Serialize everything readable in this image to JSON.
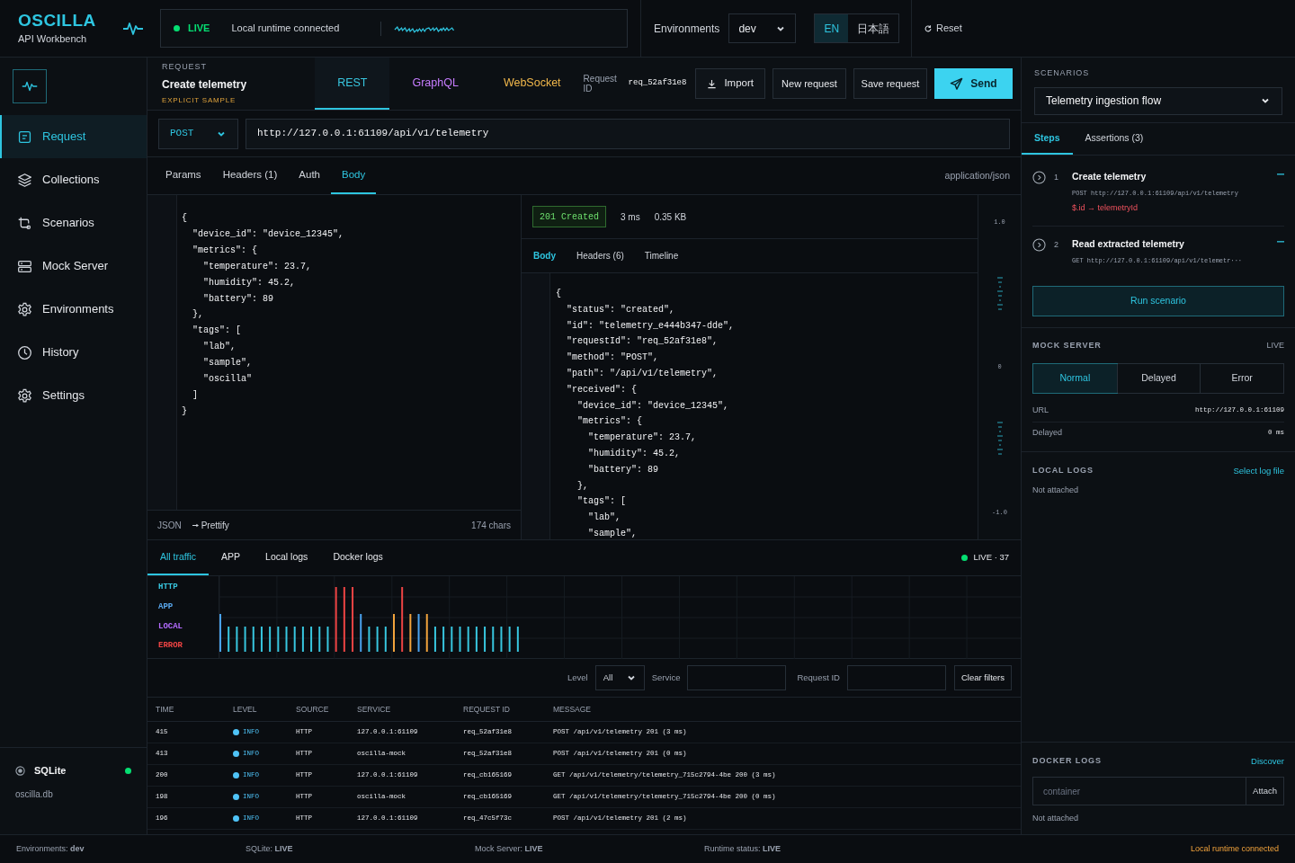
{
  "brand": {
    "name": "OSCILLA",
    "subtitle": "API Workbench"
  },
  "live_banner": {
    "status": "LIVE",
    "message": "Local runtime connected"
  },
  "environment": {
    "label": "Environments",
    "value": "dev"
  },
  "languages": [
    {
      "label": "EN",
      "selected": true
    },
    {
      "label": "日本語",
      "selected": false
    }
  ],
  "reset": "Reset",
  "sidebar": {
    "items": [
      {
        "label": "Request",
        "selected": true
      },
      {
        "label": "Collections",
        "selected": false
      },
      {
        "label": "Scenarios",
        "selected": false
      },
      {
        "label": "Mock Server",
        "selected": false
      },
      {
        "label": "Environments",
        "selected": false
      },
      {
        "label": "History",
        "selected": false
      },
      {
        "label": "Settings",
        "selected": false
      }
    ],
    "database": {
      "name": "SQLite",
      "file": "oscilla.db",
      "connected": true
    }
  },
  "request": {
    "eyebrow": "REQUEST",
    "title": "Create telemetry",
    "tag": "EXPLICIT SAMPLE",
    "protocols": [
      {
        "label": "REST",
        "selected": true,
        "color": "#38c7e0"
      },
      {
        "label": "GraphQL",
        "selected": false,
        "color": "#c77dff"
      },
      {
        "label": "WebSocket",
        "selected": false,
        "color": "#f2b84b"
      }
    ],
    "request_id_label": "Request ID",
    "request_id": "req_52af31e8",
    "actions": [
      {
        "label": "Import",
        "kind": "import"
      },
      {
        "label": "New request",
        "kind": "plain"
      },
      {
        "label": "Save request",
        "kind": "plain"
      },
      {
        "label": "Send",
        "kind": "primary"
      }
    ],
    "method": "POST",
    "url": "http://127.0.0.1:61109/api/v1/telemetry",
    "tabs": [
      {
        "label": "Params",
        "selected": false
      },
      {
        "label": "Headers (1)",
        "selected": false
      },
      {
        "label": "Auth",
        "selected": false
      },
      {
        "label": "Body",
        "selected": true
      }
    ],
    "content_type": "application/json",
    "body": "{\n  \"device_id\": \"device_12345\",\n  \"metrics\": {\n    \"temperature\": 23.7,\n    \"humidity\": 45.2,\n    \"battery\": 89\n  },\n  \"tags\": [\n    \"lab\",\n    \"sample\",\n    \"oscilla\"\n  ]\n}",
    "format": "JSON",
    "prettify": "Prettify",
    "chars": "174 chars"
  },
  "response": {
    "status": "201 Created",
    "time": "3 ms",
    "size": "0.35 KB",
    "tabs": [
      {
        "label": "Body",
        "selected": true
      },
      {
        "label": "Headers (6)",
        "selected": false
      },
      {
        "label": "Timeline",
        "selected": false
      }
    ],
    "body": "{\n  \"status\": \"created\",\n  \"id\": \"telemetry_e444b347-dde\",\n  \"requestId\": \"req_52af31e8\",\n  \"method\": \"POST\",\n  \"path\": \"/api/v1/telemetry\",\n  \"received\": {\n    \"device_id\": \"device_12345\",\n    \"metrics\": {\n      \"temperature\": 23.7,\n      \"humidity\": 45.2,\n      \"battery\": 89\n    },\n    \"tags\": [\n      \"lab\",\n      \"sample\",",
    "minimap_labels": [
      "1.0",
      "0",
      "-1.0"
    ]
  },
  "logs": {
    "tabs": [
      {
        "label": "All traffic",
        "selected": true
      },
      {
        "label": "APP",
        "selected": false
      },
      {
        "label": "Local logs",
        "selected": false
      },
      {
        "label": "Docker logs",
        "selected": false
      }
    ],
    "live": "LIVE · 37",
    "lanes": [
      {
        "label": "HTTP",
        "color": "#38c7e0"
      },
      {
        "label": "APP",
        "color": "#5aa9f0"
      },
      {
        "label": "LOCAL",
        "color": "#b36bff"
      },
      {
        "label": "ERROR",
        "color": "#ef4444"
      }
    ],
    "filters": {
      "level_label": "Level",
      "level": "All",
      "service_label": "Service",
      "request_id_label": "Request ID",
      "clear": "Clear filters"
    },
    "columns": [
      "TIME",
      "LEVEL",
      "SOURCE",
      "SERVICE",
      "REQUEST ID",
      "MESSAGE"
    ],
    "rows": [
      {
        "time": "415",
        "level": "INFO",
        "color": "#4fc3f7",
        "source": "HTTP",
        "service": "127.0.0.1:61109",
        "request_id": "req_52af31e8",
        "message": "POST /api/v1/telemetry 201 (3 ms)"
      },
      {
        "time": "413",
        "level": "INFO",
        "color": "#4fc3f7",
        "source": "HTTP",
        "service": "oscilla-mock",
        "request_id": "req_52af31e8",
        "message": "POST /api/v1/telemetry 201 (0 ms)"
      },
      {
        "time": "200",
        "level": "INFO",
        "color": "#4fc3f7",
        "source": "HTTP",
        "service": "127.0.0.1:61109",
        "request_id": "req_cb165169",
        "message": "GET /api/v1/telemetry/telemetry_715c2794-4be 200 (3 ms)"
      },
      {
        "time": "198",
        "level": "INFO",
        "color": "#4fc3f7",
        "source": "HTTP",
        "service": "oscilla-mock",
        "request_id": "req_cb165169",
        "message": "GET /api/v1/telemetry/telemetry_715c2794-4be 200 (0 ms)"
      },
      {
        "time": "196",
        "level": "INFO",
        "color": "#4fc3f7",
        "source": "HTTP",
        "service": "127.0.0.1:61109",
        "request_id": "req_47c5f73c",
        "message": "POST /api/v1/telemetry 201 (2 ms)"
      }
    ]
  },
  "scenarios": {
    "title": "SCENARIOS",
    "selected_scenario": "Telemetry ingestion flow",
    "tabs": [
      {
        "label": "Steps",
        "selected": true
      },
      {
        "label": "Assertions (3)",
        "selected": false
      }
    ],
    "steps": [
      {
        "number": "1",
        "title": "Create telemetry",
        "detail": "POST http://127.0.0.1:61109/api/v1/telemetry",
        "extract": "$.id → telemetryId"
      },
      {
        "number": "2",
        "title": "Read extracted telemetry",
        "detail": "GET http://127.0.0.1:61109/api/v1/telemetr···"
      }
    ],
    "run": "Run scenario"
  },
  "mock_server": {
    "title": "MOCK SERVER",
    "status": "LIVE",
    "modes": [
      {
        "label": "Normal",
        "selected": true
      },
      {
        "label": "Delayed",
        "selected": false
      },
      {
        "label": "Error",
        "selected": false
      }
    ],
    "fields": [
      {
        "label": "URL",
        "value": "http://127.0.0.1:61109"
      },
      {
        "label": "Delayed",
        "value": "0 ms"
      }
    ]
  },
  "local_logs": {
    "title": "LOCAL LOGS",
    "action": "Select log file",
    "status": "Not attached"
  },
  "docker_logs": {
    "title": "DOCKER LOGS",
    "action": "Discover",
    "placeholder": "container",
    "button": "Attach",
    "status": "Not attached"
  },
  "status_bar": {
    "items": [
      "Environments: **dev**",
      "SQLite: **LIVE**",
      "Mock Server: **LIVE**",
      "Runtime status: **LIVE**"
    ],
    "right": "Local runtime connected"
  }
}
